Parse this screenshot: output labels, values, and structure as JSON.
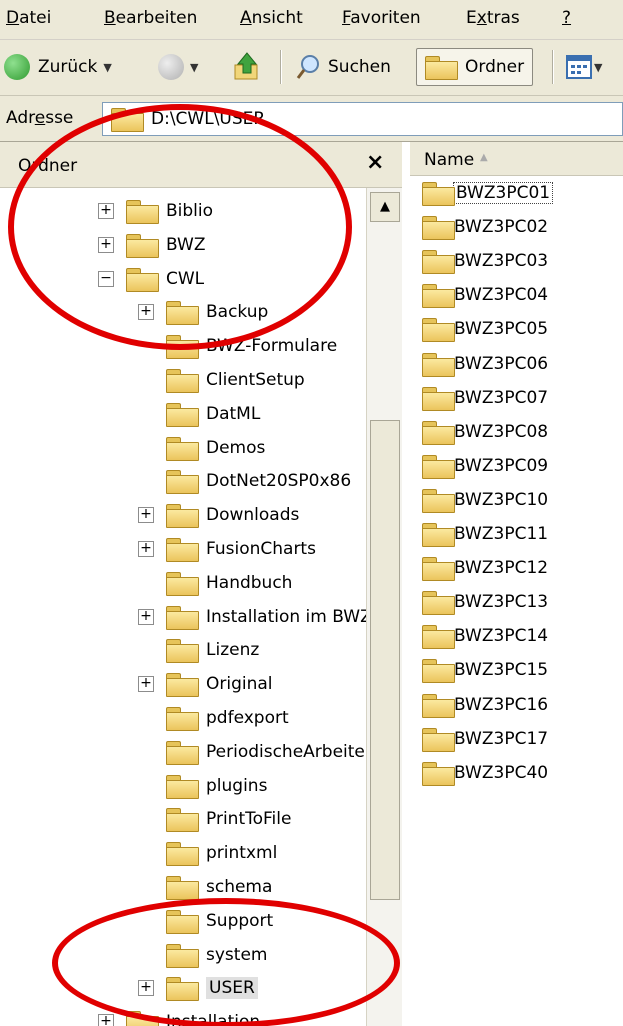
{
  "menubar": {
    "items": [
      {
        "label": "Datei",
        "mnemonic": "D",
        "rest": "atei"
      },
      {
        "label": "Bearbeiten",
        "mnemonic": "B",
        "rest": "earbeiten"
      },
      {
        "label": "Ansicht",
        "mnemonic": "A",
        "rest": "nsicht"
      },
      {
        "label": "Favoriten",
        "mnemonic": "F",
        "rest": "avoriten"
      },
      {
        "label": "Extras",
        "pre": "E",
        "mnemonic": "x",
        "rest": "tras"
      },
      {
        "label": "?",
        "mnemonic": "?",
        "rest": ""
      }
    ]
  },
  "toolbar": {
    "back_label": "Zurück",
    "search_label": "Suchen",
    "folders_label": "Ordner",
    "colors": {
      "back": "#3aa53a",
      "forward": "#b8b8b8",
      "up": "#3a9a2a"
    }
  },
  "address": {
    "label_pre": "Adr",
    "label_mnemonic": "e",
    "label_post": "sse",
    "path": "D:\\CWL\\USER"
  },
  "left_pane": {
    "title": "Ordner",
    "close_glyph": "×",
    "scroll_up_glyph": "▲",
    "expand_glyph": "+",
    "collapse_glyph": "−",
    "tree": [
      {
        "label": "Biblio",
        "level": 0,
        "expander": "plus"
      },
      {
        "label": "BWZ",
        "level": 0,
        "expander": "plus"
      },
      {
        "label": "CWL",
        "level": 0,
        "expander": "minus"
      },
      {
        "label": "Backup",
        "level": 1,
        "expander": "plus"
      },
      {
        "label": "BWZ-Formulare",
        "level": 1,
        "expander": "none"
      },
      {
        "label": "ClientSetup",
        "level": 1,
        "expander": "none"
      },
      {
        "label": "DatML",
        "level": 1,
        "expander": "none"
      },
      {
        "label": "Demos",
        "level": 1,
        "expander": "none"
      },
      {
        "label": "DotNet20SP0x86",
        "level": 1,
        "expander": "none"
      },
      {
        "label": "Downloads",
        "level": 1,
        "expander": "plus"
      },
      {
        "label": "FusionCharts",
        "level": 1,
        "expander": "plus"
      },
      {
        "label": "Handbuch",
        "level": 1,
        "expander": "none"
      },
      {
        "label": "Installation im BWZ",
        "level": 1,
        "expander": "plus"
      },
      {
        "label": "Lizenz",
        "level": 1,
        "expander": "none"
      },
      {
        "label": "Original",
        "level": 1,
        "expander": "plus"
      },
      {
        "label": "pdfexport",
        "level": 1,
        "expander": "none"
      },
      {
        "label": "PeriodischeArbeiten",
        "level": 1,
        "expander": "none"
      },
      {
        "label": "plugins",
        "level": 1,
        "expander": "none"
      },
      {
        "label": "PrintToFile",
        "level": 1,
        "expander": "none"
      },
      {
        "label": "printxml",
        "level": 1,
        "expander": "none"
      },
      {
        "label": "schema",
        "level": 1,
        "expander": "none"
      },
      {
        "label": "Support",
        "level": 1,
        "expander": "none"
      },
      {
        "label": "system",
        "level": 1,
        "expander": "none"
      },
      {
        "label": "USER",
        "level": 1,
        "expander": "plus",
        "selected": true
      },
      {
        "label": "Installation",
        "level": 0,
        "expander": "plus"
      }
    ]
  },
  "right_pane": {
    "column_name": "Name",
    "sort_glyph": "▲",
    "files": [
      "BWZ3PC01",
      "BWZ3PC02",
      "BWZ3PC03",
      "BWZ3PC04",
      "BWZ3PC05",
      "BWZ3PC06",
      "BWZ3PC07",
      "BWZ3PC08",
      "BWZ3PC09",
      "BWZ3PC10",
      "BWZ3PC11",
      "BWZ3PC12",
      "BWZ3PC13",
      "BWZ3PC14",
      "BWZ3PC15",
      "BWZ3PC16",
      "BWZ3PC17",
      "BWZ3PC40"
    ]
  },
  "annotations": {
    "highlight_color": "#e00000"
  }
}
